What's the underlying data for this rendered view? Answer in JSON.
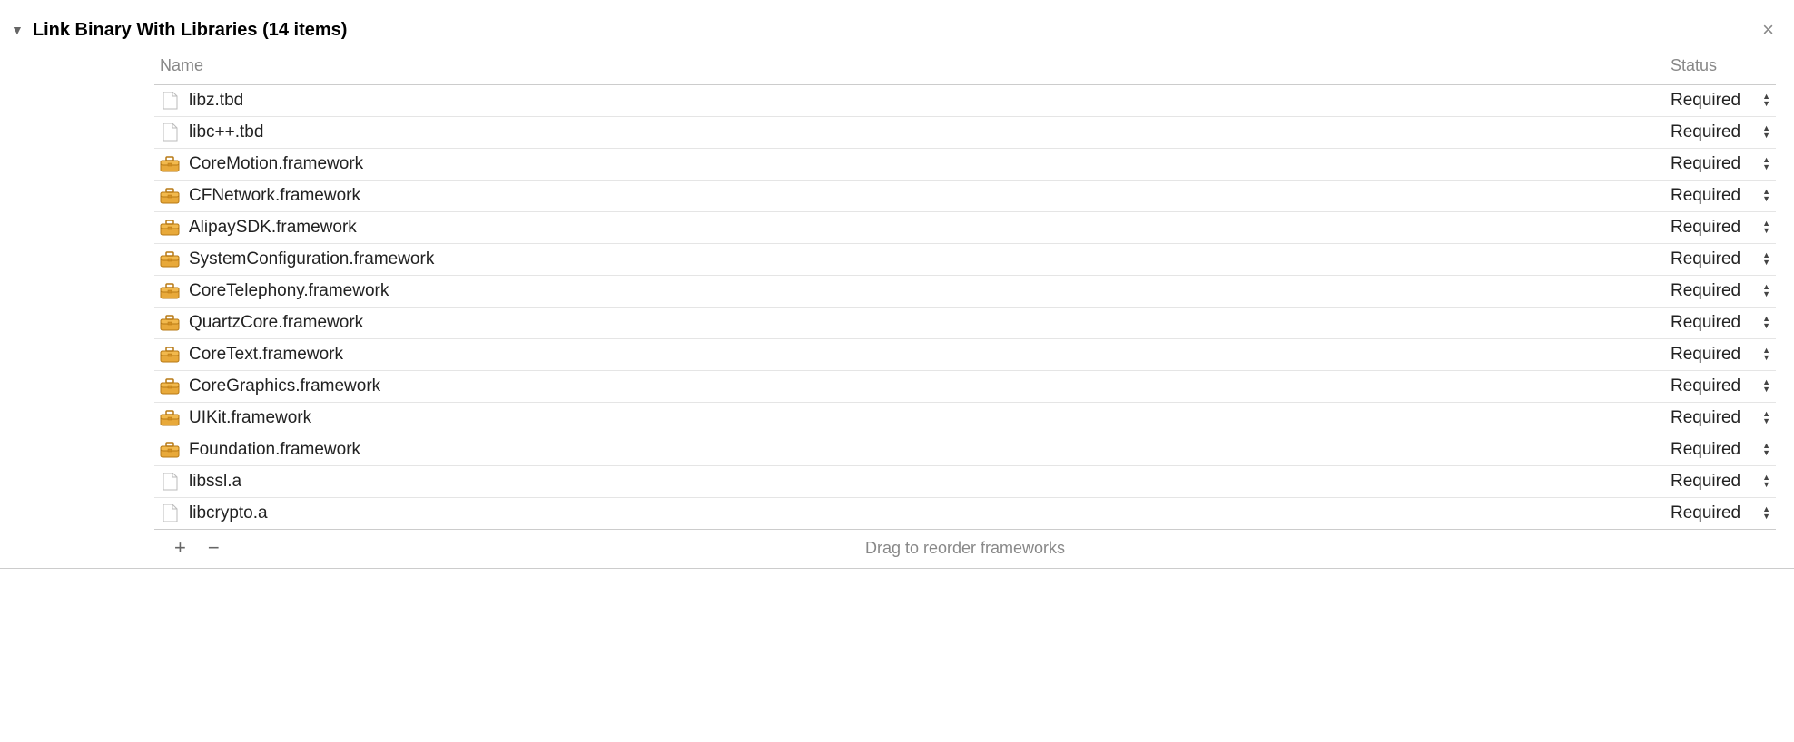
{
  "section": {
    "title": "Link Binary With Libraries (14 items)"
  },
  "columns": {
    "name": "Name",
    "status": "Status"
  },
  "items": [
    {
      "name": "libz.tbd",
      "icon": "file",
      "status": "Required"
    },
    {
      "name": "libc++.tbd",
      "icon": "file",
      "status": "Required"
    },
    {
      "name": "CoreMotion.framework",
      "icon": "framework",
      "status": "Required"
    },
    {
      "name": "CFNetwork.framework",
      "icon": "framework",
      "status": "Required"
    },
    {
      "name": "AlipaySDK.framework",
      "icon": "framework",
      "status": "Required"
    },
    {
      "name": "SystemConfiguration.framework",
      "icon": "framework",
      "status": "Required"
    },
    {
      "name": "CoreTelephony.framework",
      "icon": "framework",
      "status": "Required"
    },
    {
      "name": "QuartzCore.framework",
      "icon": "framework",
      "status": "Required"
    },
    {
      "name": "CoreText.framework",
      "icon": "framework",
      "status": "Required"
    },
    {
      "name": "CoreGraphics.framework",
      "icon": "framework",
      "status": "Required"
    },
    {
      "name": "UIKit.framework",
      "icon": "framework",
      "status": "Required"
    },
    {
      "name": "Foundation.framework",
      "icon": "framework",
      "status": "Required"
    },
    {
      "name": "libssl.a",
      "icon": "file",
      "status": "Required"
    },
    {
      "name": "libcrypto.a",
      "icon": "file",
      "status": "Required"
    }
  ],
  "footer": {
    "hint": "Drag to reorder frameworks",
    "add": "+",
    "remove": "−"
  },
  "close": "×"
}
